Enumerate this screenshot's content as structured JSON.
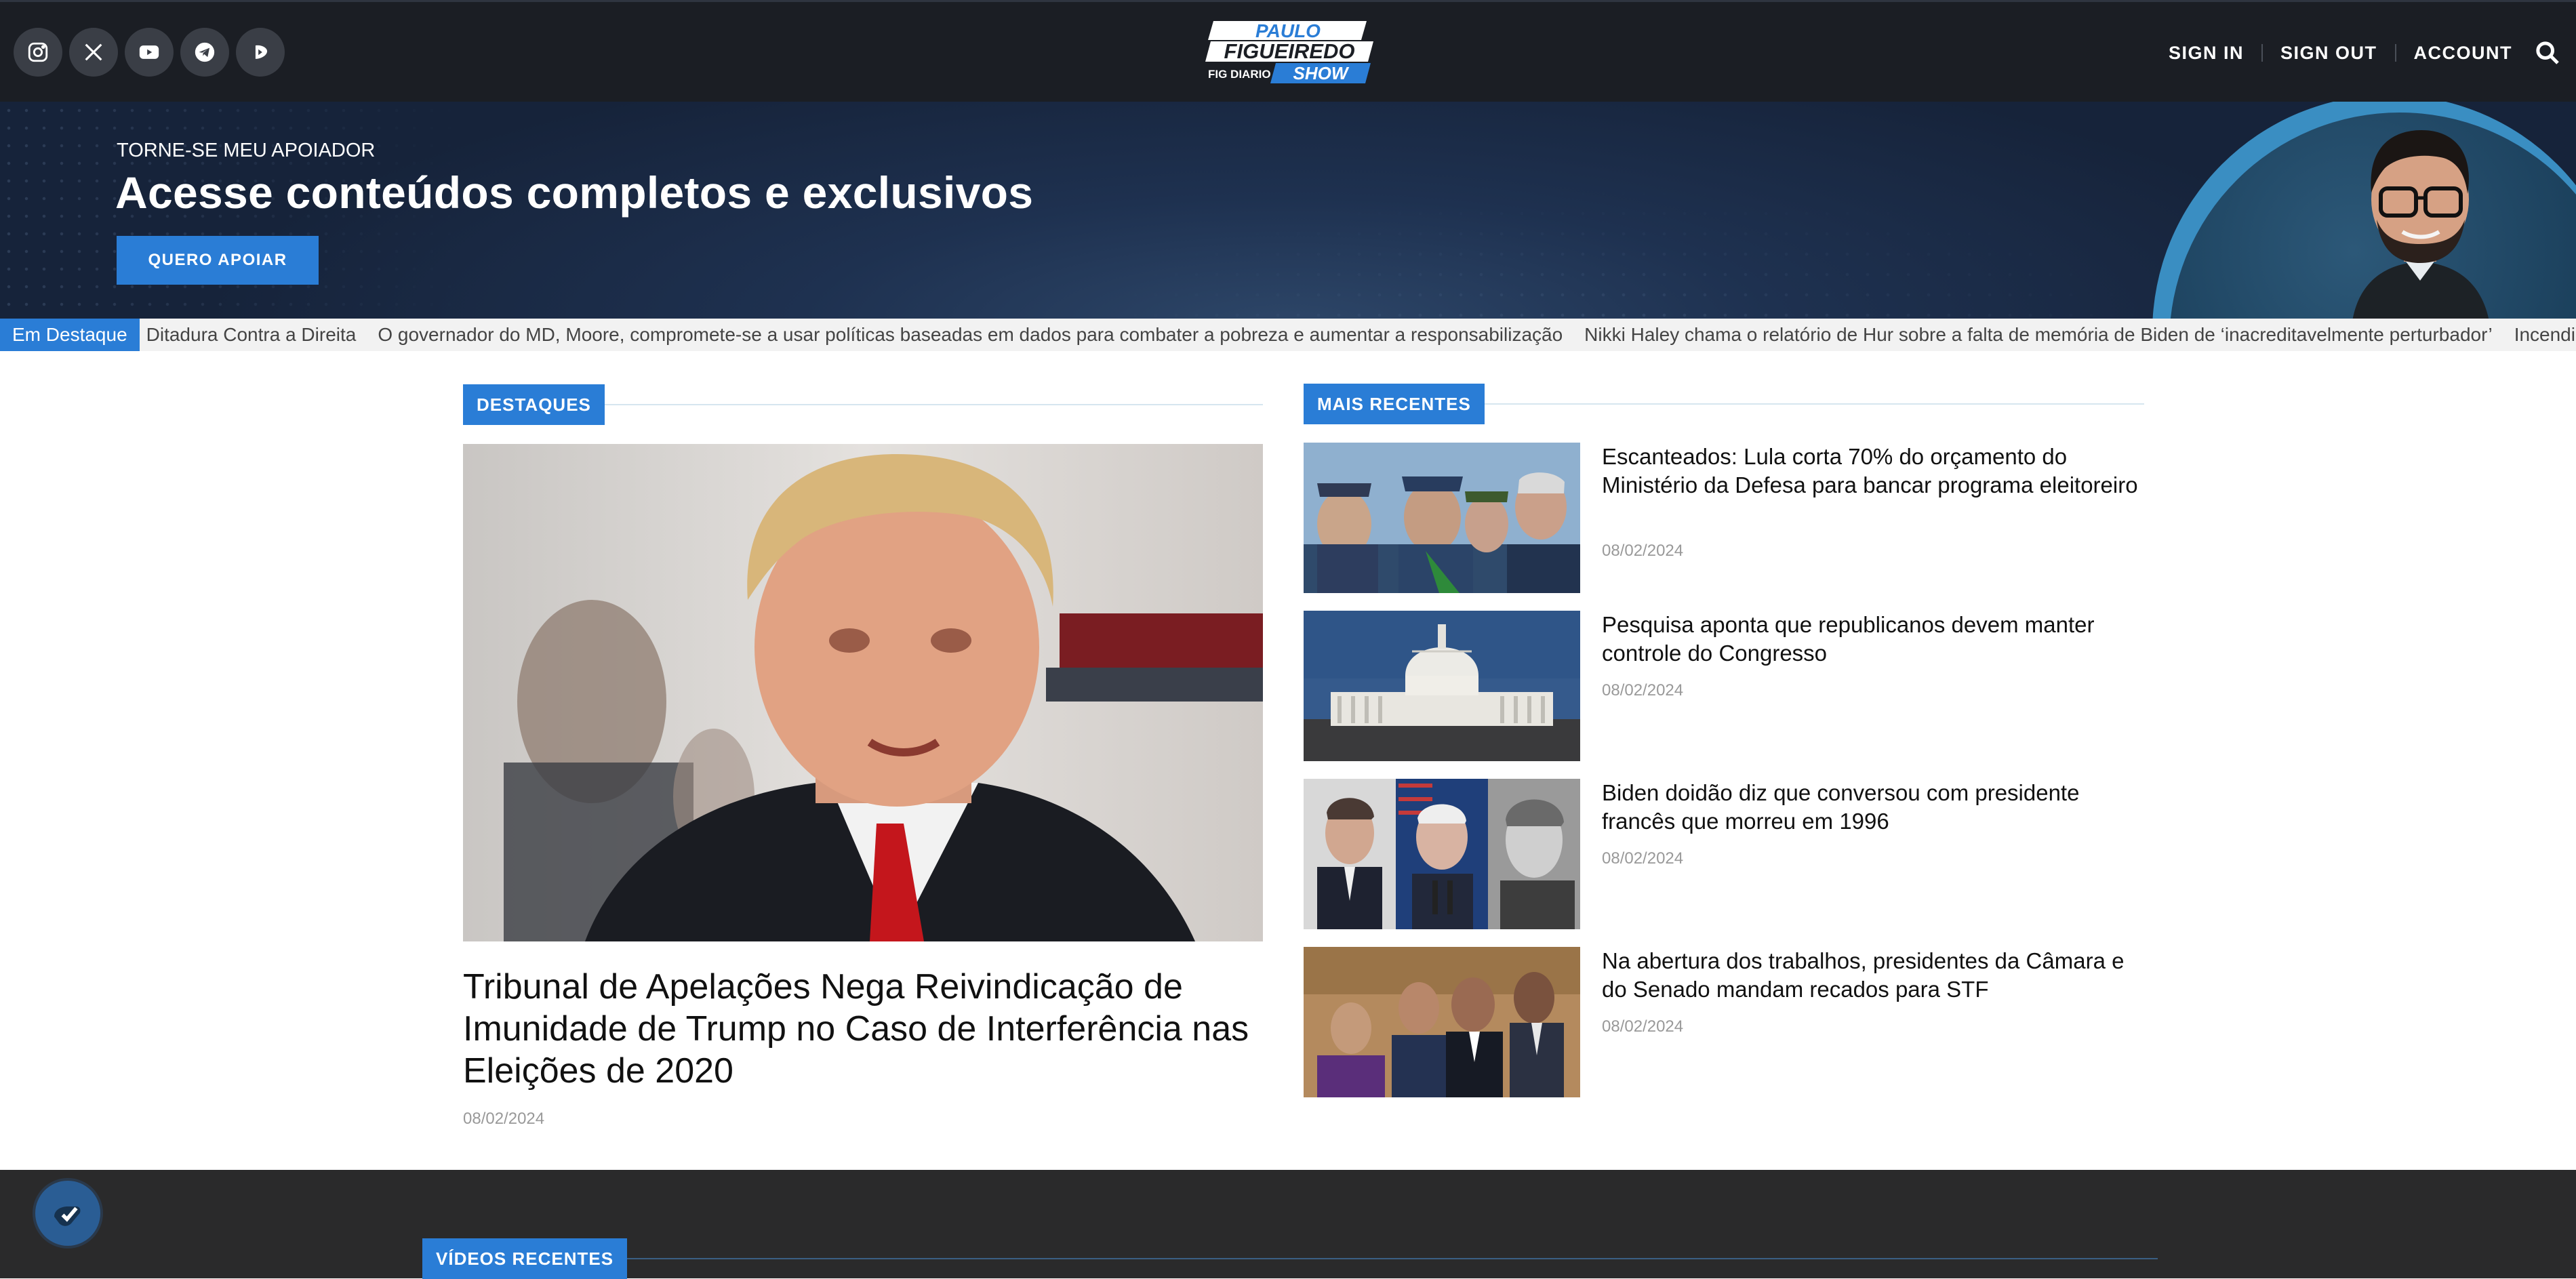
{
  "header": {
    "logo": {
      "line1": "PAULO",
      "line2": "FIGUEIREDO",
      "line3": "FIG DIARIO",
      "line4": "SHOW"
    },
    "social": [
      "instagram-icon",
      "x-icon",
      "youtube-icon",
      "telegram-icon",
      "rumble-icon"
    ],
    "nav": {
      "sign_in": "SIGN IN",
      "sign_out": "SIGN OUT",
      "account": "ACCOUNT"
    }
  },
  "banner": {
    "kicker": "TORNE-SE MEU APOIADOR",
    "title": "Acesse conteúdos completos e exclusivos",
    "button": "QUERO APOIAR"
  },
  "ticker": {
    "label": "Em Destaque",
    "items": [
      "Ditadura Contra a Direita",
      "O governador do MD, Moore, compromete-se a usar políticas baseadas em dados para combater a pobreza e aumentar a responsabilização",
      "Nikki Haley chama o relatório de Hur sobre a falta de memória de Biden de ‘inacreditavelmente perturbador’",
      "Incendiári"
    ]
  },
  "destaques": {
    "heading": "DESTAQUES",
    "title": "Tribunal de Apelações Nega Reivindicação de Imunidade de Trump no Caso de Interferência nas Eleições de 2020",
    "date": "08/02/2024"
  },
  "recentes": {
    "heading": "MAIS RECENTES",
    "items": [
      {
        "title": "Escanteados: Lula corta 70% do orçamento do Ministério da Defesa para bancar programa eleitoreiro",
        "date": "08/02/2024"
      },
      {
        "title": "Pesquisa aponta que republicanos devem manter controle do Congresso",
        "date": "08/02/2024"
      },
      {
        "title": "Biden doidão diz que conversou com presidente francês que morreu em 1996",
        "date": "08/02/2024"
      },
      {
        "title": "Na abertura dos trabalhos, presidentes da Câmara e do Senado mandam recados para STF",
        "date": "08/02/2024"
      }
    ]
  },
  "videos": {
    "heading": "VÍDEOS RECENTES"
  },
  "colors": {
    "accent": "#2a7dd6",
    "header_bg": "#1b1e24",
    "banner_bg": "#1e3150",
    "dark_band": "#2a2a2b"
  }
}
